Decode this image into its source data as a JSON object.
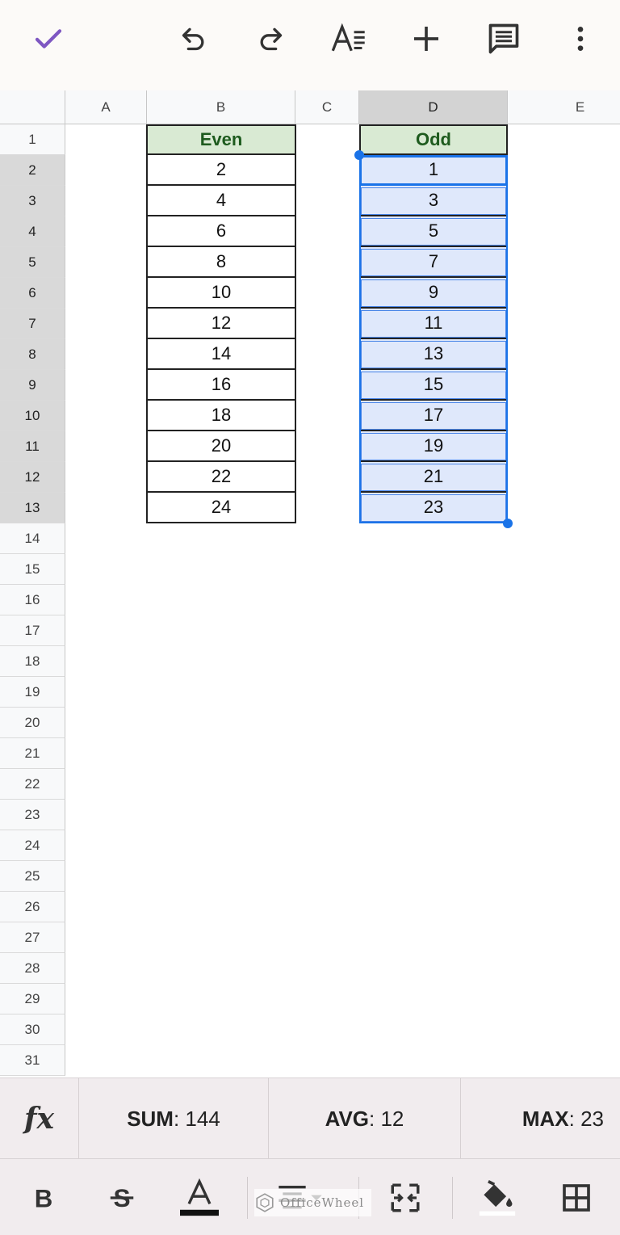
{
  "toolbar": {
    "icons": [
      "check-icon",
      "undo-icon",
      "redo-icon",
      "text-format-icon",
      "add-icon",
      "comment-icon",
      "more-vert-icon"
    ],
    "accent": "#7e57c2"
  },
  "columns": [
    "A",
    "B",
    "C",
    "D",
    "E"
  ],
  "selected_column": "D",
  "rows": [
    "1",
    "2",
    "3",
    "4",
    "5",
    "6",
    "7",
    "8",
    "9",
    "10",
    "11",
    "12",
    "13",
    "14",
    "15",
    "16",
    "17",
    "18",
    "19",
    "20",
    "21",
    "22",
    "23",
    "24",
    "25",
    "26",
    "27",
    "28",
    "29",
    "30",
    "31"
  ],
  "selected_rows": [
    "2",
    "3",
    "4",
    "5",
    "6",
    "7",
    "8",
    "9",
    "10",
    "11",
    "12",
    "13"
  ],
  "even": {
    "header": "Even",
    "values": [
      "2",
      "4",
      "6",
      "8",
      "10",
      "12",
      "14",
      "16",
      "18",
      "20",
      "22",
      "24"
    ]
  },
  "odd": {
    "header": "Odd",
    "values": [
      "1",
      "3",
      "5",
      "7",
      "9",
      "11",
      "13",
      "15",
      "17",
      "19",
      "21",
      "23"
    ]
  },
  "stats": {
    "sum_label": "SUM",
    "sum_value": ": 144",
    "avg_label": "AVG",
    "avg_value": ": 12",
    "max_label": "MAX",
    "max_value": ": 23"
  },
  "fx_label": "fx",
  "watermark": "OfficeWheel",
  "colors": {
    "header_green": "#d9ead3",
    "header_text": "#1e5b1e",
    "selection_fill": "#dfe8fb",
    "selection_border": "#1a73e8"
  }
}
